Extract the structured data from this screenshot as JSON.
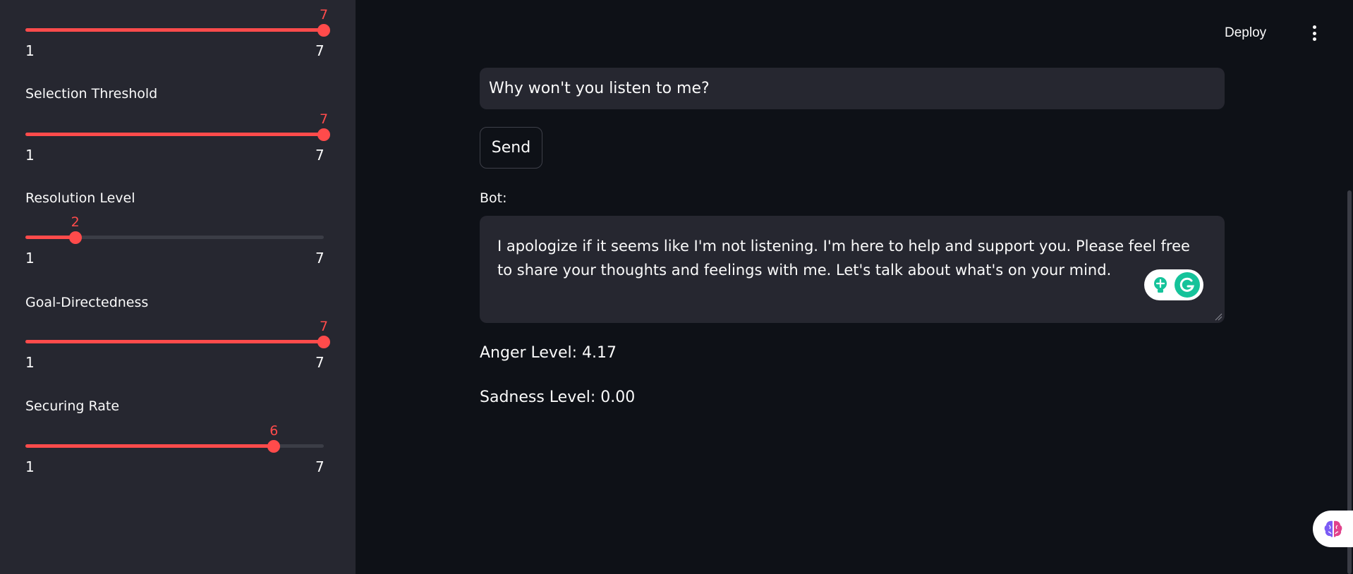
{
  "sidebar": {
    "sliders": [
      {
        "label": "",
        "value": "7",
        "min": "1",
        "max": "7"
      },
      {
        "label": "Selection Threshold",
        "value": "7",
        "min": "1",
        "max": "7"
      },
      {
        "label": "Resolution Level",
        "value": "2",
        "min": "1",
        "max": "7"
      },
      {
        "label": "Goal-Directedness",
        "value": "7",
        "min": "1",
        "max": "7"
      },
      {
        "label": "Securing Rate",
        "value": "6",
        "min": "1",
        "max": "7"
      }
    ]
  },
  "header": {
    "deploy_label": "Deploy",
    "menu_icon": "vertical-dots-icon"
  },
  "chat": {
    "input_value": "Why won't you listen to me?",
    "send_label": "Send",
    "bot_label": "Bot:",
    "bot_response": "I apologize if it seems like I'm not listening. I'm here to help and support you. Please feel free to share your thoughts and feelings with me. Let's talk about what's on your mind."
  },
  "metrics": {
    "anger": "Anger Level: 4.17",
    "sadness": "Sadness Level: 0.00"
  },
  "colors": {
    "accent": "#ff4b4b",
    "sidebar_bg": "#262730",
    "main_bg": "#0e1117",
    "grammarly": "#15c39a"
  },
  "icons": {
    "grammarly_bulb": "lightbulb-icon",
    "grammarly_logo": "grammarly-g-icon",
    "brain": "brain-icon"
  }
}
